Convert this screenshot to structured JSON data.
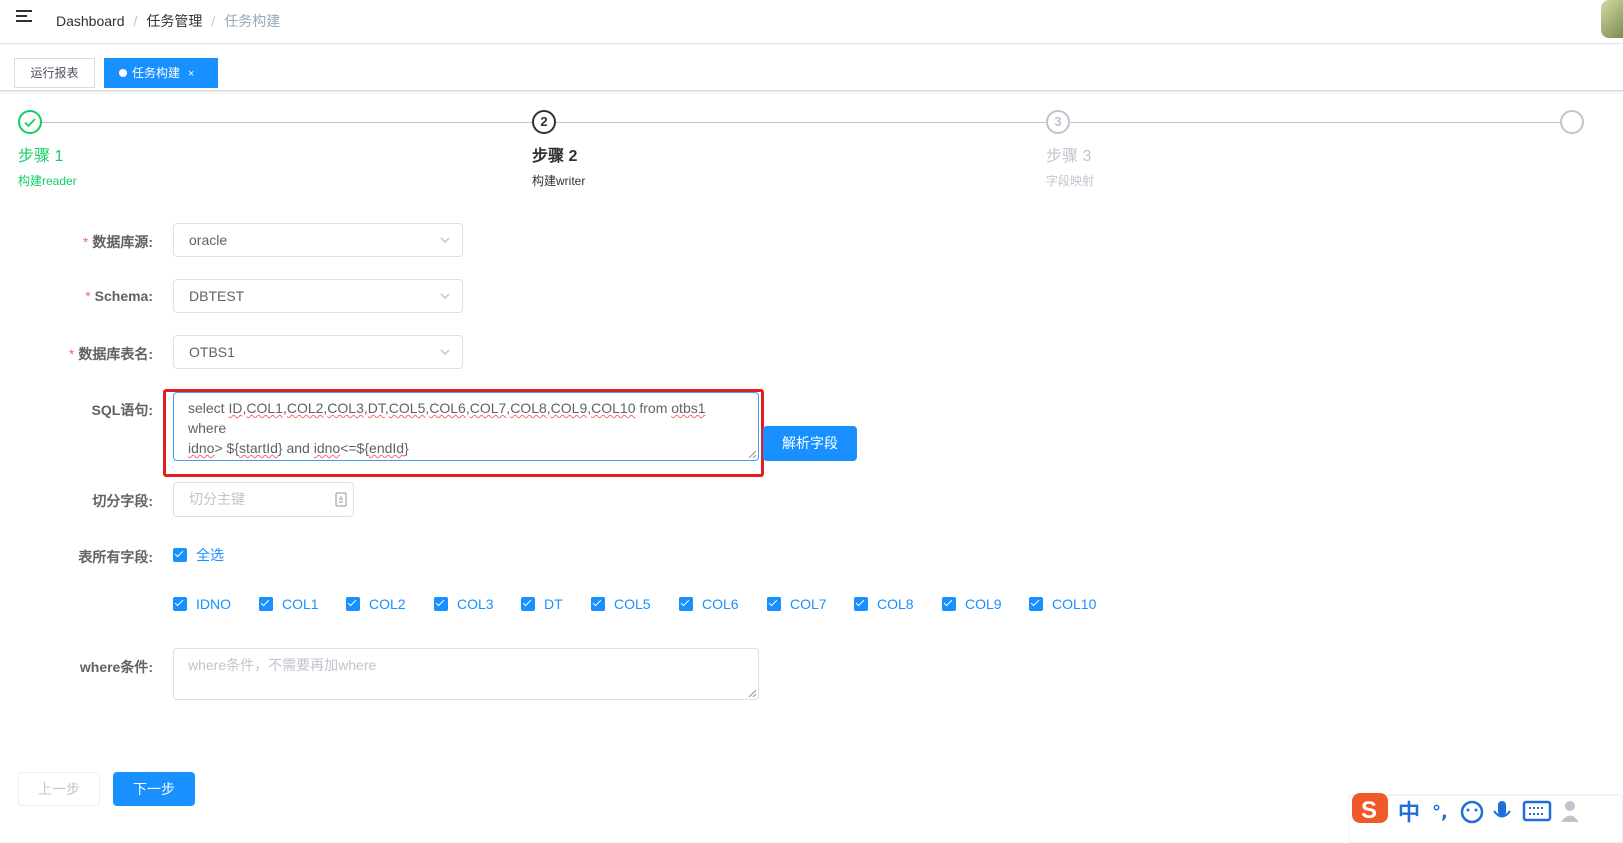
{
  "navbar": {
    "breadcrumbs": [
      "Dashboard",
      "任务管理",
      "任务构建"
    ],
    "separator": "/"
  },
  "tags": [
    {
      "label": "运行报表",
      "active": false
    },
    {
      "label": "任务构建",
      "active": true,
      "close": "×"
    }
  ],
  "steps": [
    {
      "icon": "check-icon",
      "title": "步骤 1",
      "desc": "构建reader",
      "status": "success"
    },
    {
      "number": "2",
      "title": "步骤 2",
      "desc": "构建writer",
      "status": "process"
    },
    {
      "number": "3",
      "title": "步骤 3",
      "desc": "字段映射",
      "status": "wait"
    },
    {
      "status": "wait"
    }
  ],
  "form": {
    "datasource": {
      "label": "数据库源:",
      "value": "oracle",
      "required": true
    },
    "schema": {
      "label": "Schema:",
      "value": "DBTEST",
      "required": true
    },
    "table": {
      "label": "数据库表名:",
      "value": "OTBS1",
      "required": true
    },
    "sql": {
      "label": "SQL语句:",
      "value": "select ID,COL1,COL2,COL3,DT,COL5,COL6,COL7,COL8,COL9,COL10 from otbs1 where idno> ${startId} and idno<=${endId}",
      "line1": [
        "select ",
        "ID",
        ",",
        "COL1",
        ",",
        "COL2",
        ",",
        "COL3",
        ",",
        "DT",
        ",",
        "COL5",
        ",",
        "COL6",
        ",",
        "COL7",
        ",",
        "COL8",
        ",",
        "COL9",
        ",",
        "COL10",
        " from ",
        "otbs1",
        " where"
      ],
      "line2": [
        "idno",
        "> ${",
        "startId",
        "} and ",
        "idno",
        "<=${",
        "endId",
        "}"
      ]
    },
    "parse_button": "解析字段",
    "split": {
      "label": "切分字段:",
      "placeholder": "切分主键"
    },
    "all_fields": {
      "label": "表所有字段:",
      "select_all": "全选"
    },
    "columns": [
      "IDNO",
      "COL1",
      "COL2",
      "COL3",
      "DT",
      "COL5",
      "COL6",
      "COL7",
      "COL8",
      "COL9",
      "COL10"
    ],
    "where": {
      "label": "where条件:",
      "placeholder": "where条件，不需要再加where"
    }
  },
  "buttons": {
    "prev": "上一步",
    "next": "下一步"
  },
  "ime": {
    "chars": [
      "中",
      "°,"
    ]
  },
  "colors": {
    "primary": "#1890ff",
    "success": "#13ce66",
    "required": "#f56c6c",
    "highlight": "#e02020"
  }
}
